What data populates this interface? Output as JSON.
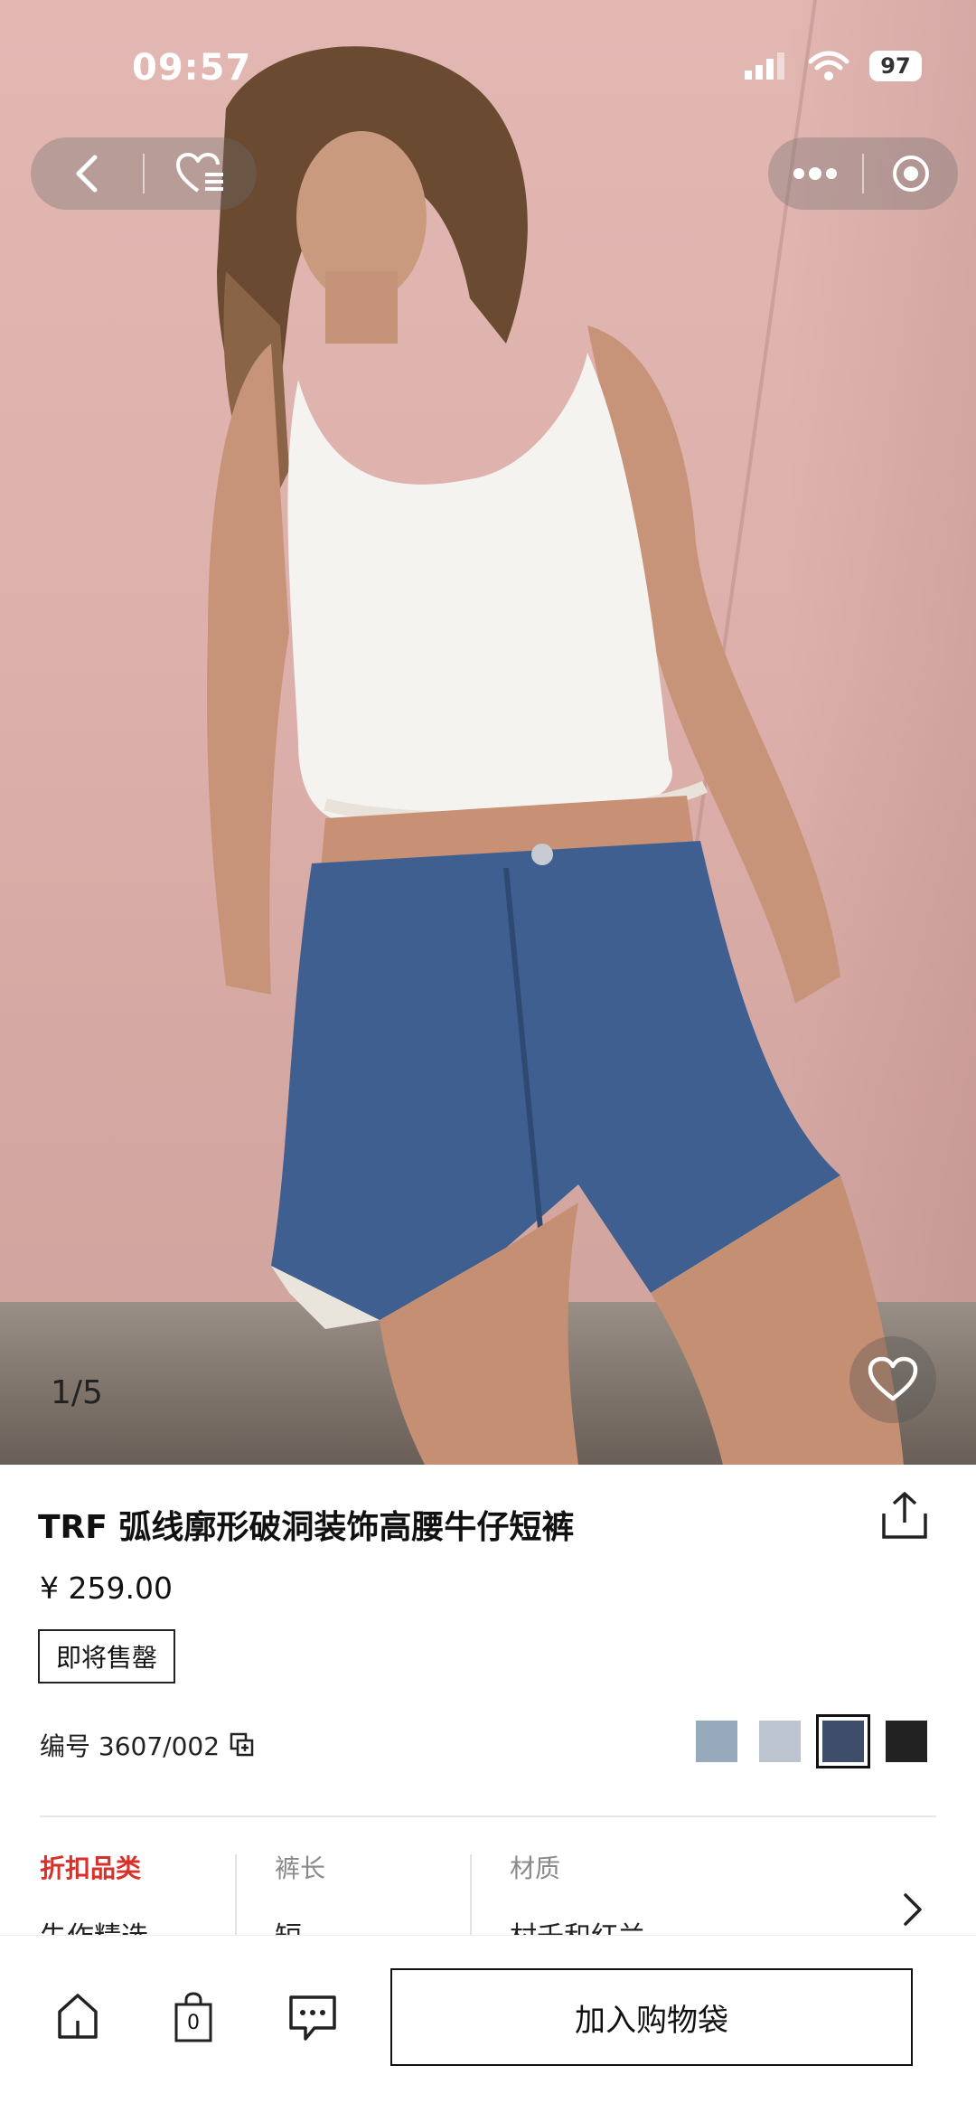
{
  "status_bar": {
    "time": "09:57",
    "battery": "97"
  },
  "gallery": {
    "pager": "1/5"
  },
  "product": {
    "title": "TRF 弧线廓形破洞装饰高腰牛仔短裤",
    "price": "¥ 259.00",
    "badge": "即将售罄",
    "sku_label": "编号 3607/002",
    "swatches": [
      "#97aabb",
      "#bcc5cf",
      "#3d4d6a",
      "#222222"
    ],
    "selected_swatch": 2
  },
  "attributes": [
    {
      "label": "折扣品类",
      "value": "失作精选",
      "highlight": true
    },
    {
      "label": "裤长",
      "value": "短"
    },
    {
      "label": "材质",
      "value": "村千和红兰"
    }
  ],
  "bottom_bar": {
    "bag_count": "0",
    "add_to_bag": "加入购物袋"
  },
  "colors": {
    "accent_red": "#d6322b",
    "ink": "#111111"
  }
}
